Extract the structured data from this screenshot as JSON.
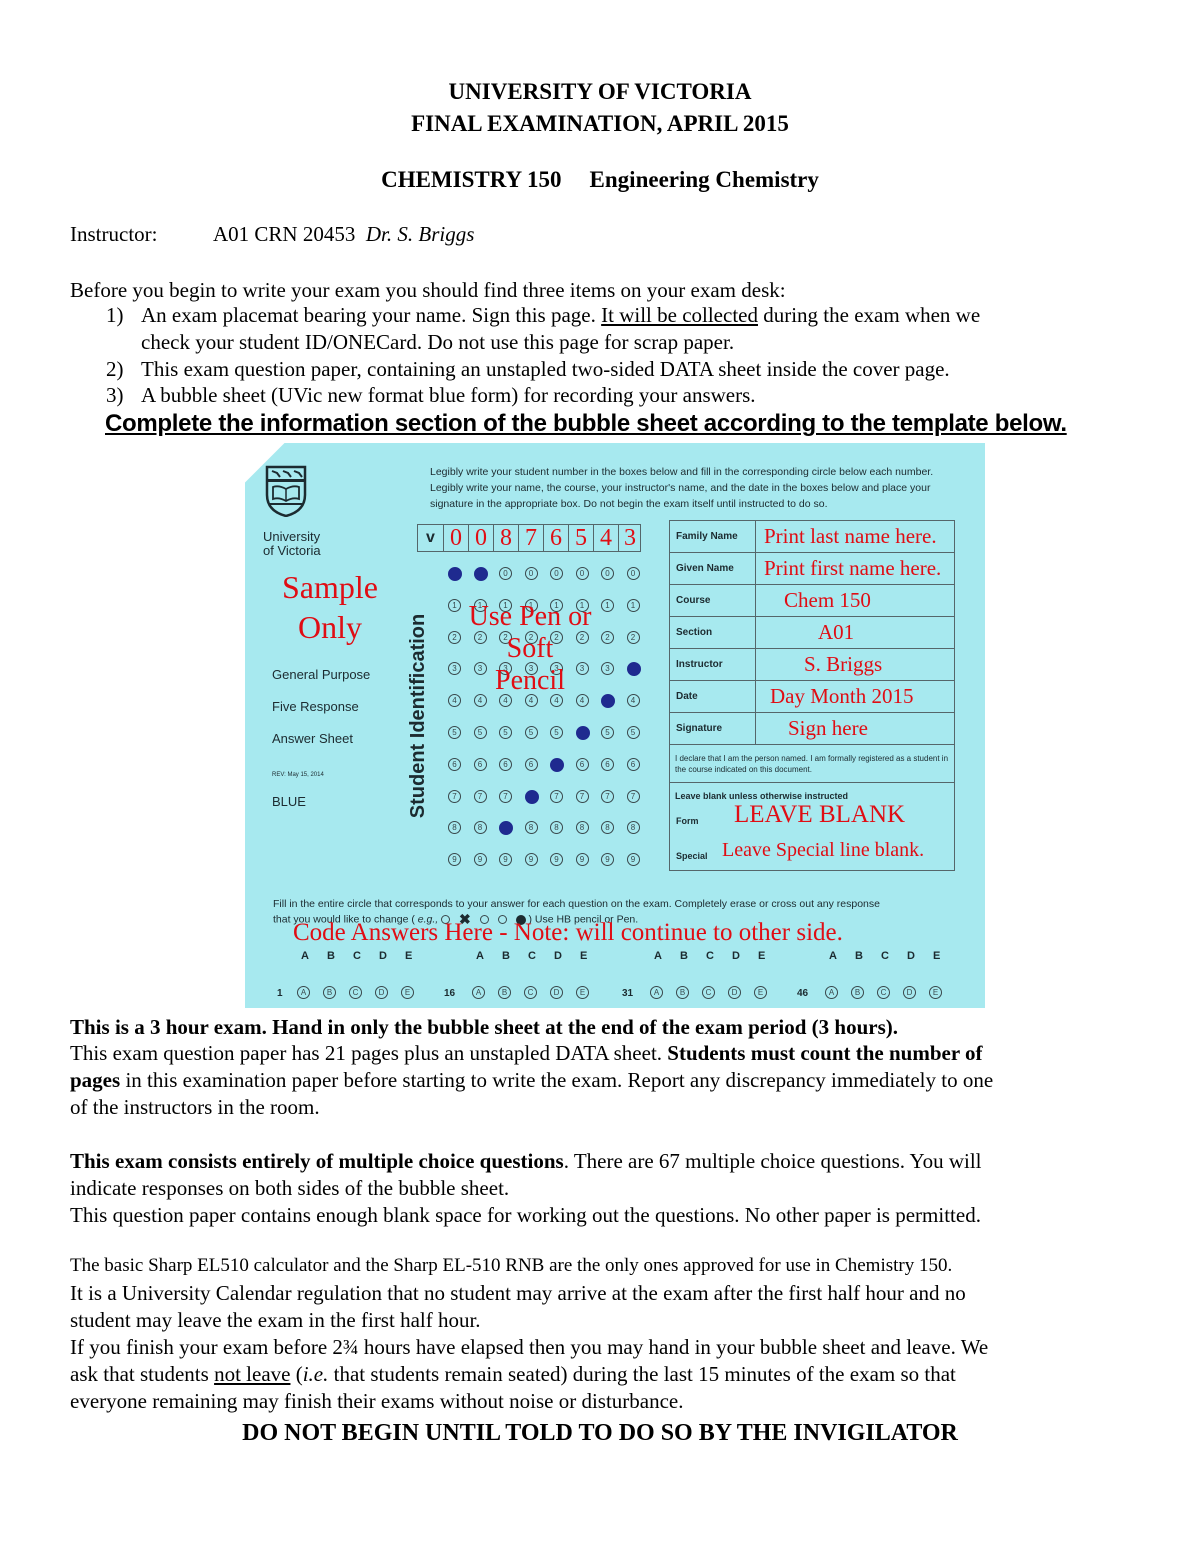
{
  "header": {
    "university": "UNIVERSITY OF VICTORIA",
    "exam": "FINAL EXAMINATION, APRIL 2015",
    "course_code": "CHEMISTRY 150",
    "course_name": "Engineering Chemistry",
    "instructor_label": "Instructor:",
    "instructor_section": "A01 CRN 20453",
    "instructor_name": "Dr. S. Briggs"
  },
  "intro": {
    "lead": "Before you begin to write your exam you should find three items on your exam desk:",
    "items": [
      {
        "num": "1)",
        "text_a": "An exam placemat bearing your name. Sign this page. ",
        "text_u": "It will be collected",
        "text_b": " during the exam when we",
        "text_c": "check your student ID/ONECard. Do not use this page for scrap paper."
      },
      {
        "num": "2)",
        "text": "This exam question paper, containing an unstapled two-sided DATA sheet inside the cover page."
      },
      {
        "num": "3)",
        "text": "A bubble sheet (UVic new format blue form) for recording your answers."
      }
    ],
    "instruction": "Complete the information section of the bubble sheet according to the template below."
  },
  "bubble_sheet": {
    "logo_line1": "University",
    "logo_line2": "of Victoria",
    "instructions": "Legibly write your student number in the boxes below and fill in the corresponding circle below each number.  Legibly write your name, the course, your instructor's name, and the date in the boxes below and place your signature in the appropriate box.  Do not begin the exam itself until instructed to do so.",
    "sample_line1": "Sample",
    "sample_line2": "Only",
    "form_type": [
      "General Purpose",
      "Five Response",
      "Answer Sheet"
    ],
    "revision": "REV: May 15, 2014",
    "color_name": "BLUE",
    "student_id_label": "Student Identification",
    "id_prefix": "v",
    "id_digits": [
      "0",
      "0",
      "8",
      "7",
      "6",
      "5",
      "4",
      "3"
    ],
    "overlay_pen": [
      "Use Pen or",
      "Soft",
      "Pencil"
    ],
    "info_fields": [
      {
        "label": "Family Name",
        "value": "Print last name here."
      },
      {
        "label": "Given Name",
        "value": "Print first name here."
      },
      {
        "label": "Course",
        "value": "Chem 150"
      },
      {
        "label": "Section",
        "value": "A01"
      },
      {
        "label": "Instructor",
        "value": "S. Briggs"
      },
      {
        "label": "Date",
        "value": "Day Month 2015"
      },
      {
        "label": "Signature",
        "value": "Sign here"
      }
    ],
    "declaration": "I declare that I am the person named.  I am formally registered as a student in the course indicated on this document.",
    "leave_blank_label": "Leave blank unless otherwise instructed",
    "form_label": "Form",
    "form_overlay": "LEAVE BLANK",
    "special_label": "Special",
    "special_overlay": "Leave Special line blank.",
    "fill_instructions_1": "Fill in the entire circle that corresponds to your answer for each question on the exam. Completely erase or cross out any response",
    "fill_instructions_2a": "that you would like to change ( ",
    "fill_instructions_eg": "e.g.,",
    "fill_instructions_2b": " )  Use HB pencil or Pen.",
    "code_answers": "Code Answers Here - Note: will continue to other side.",
    "answer_letters": [
      "A",
      "B",
      "C",
      "D",
      "E"
    ],
    "question_starts": [
      "1",
      "16",
      "31",
      "46"
    ]
  },
  "notes": {
    "p1_bold": "This is a 3 hour exam. Hand in only the bubble sheet at the end of the exam period (3 hours).",
    "p2_a": "This exam question paper has 21 pages plus an unstapled DATA sheet. ",
    "p2_bold1": "Students must count the number of",
    "p2_bold2": "pages",
    "p2_b": " in this examination paper before starting to write the exam. Report any discrepancy immediately to one",
    "p2_c": "of the instructors in the room.",
    "p3_bold": "This exam consists entirely of multiple choice questions",
    "p3_a": ". There are 67 multiple choice questions. You will",
    "p3_b": "indicate responses on both sides of the bubble sheet.",
    "p4": "This question paper contains enough blank space for working out the questions. No other paper is permitted.",
    "p5": "The basic Sharp EL510 calculator and the Sharp EL-510 RNB are the only ones approved for use in Chemistry 150.",
    "p6_a": "It is a University Calendar regulation that no student may arrive at the exam after the first half hour and no",
    "p6_b": "student may leave the exam in the first half hour.",
    "p7_a": "If you finish your exam before 2¾ hours have elapsed then you may hand in your bubble sheet and leave. We",
    "p7_b": "ask that students ",
    "p7_u": "not leave",
    "p7_c": " (",
    "p7_ie": "i.e.",
    "p7_d": " that students remain seated) during the last 15 minutes of the exam so that",
    "p7_e": "everyone remaining may finish their exams without noise or disturbance.",
    "final": "DO NOT BEGIN UNTIL TOLD TO DO SO BY THE INVIGILATOR"
  }
}
